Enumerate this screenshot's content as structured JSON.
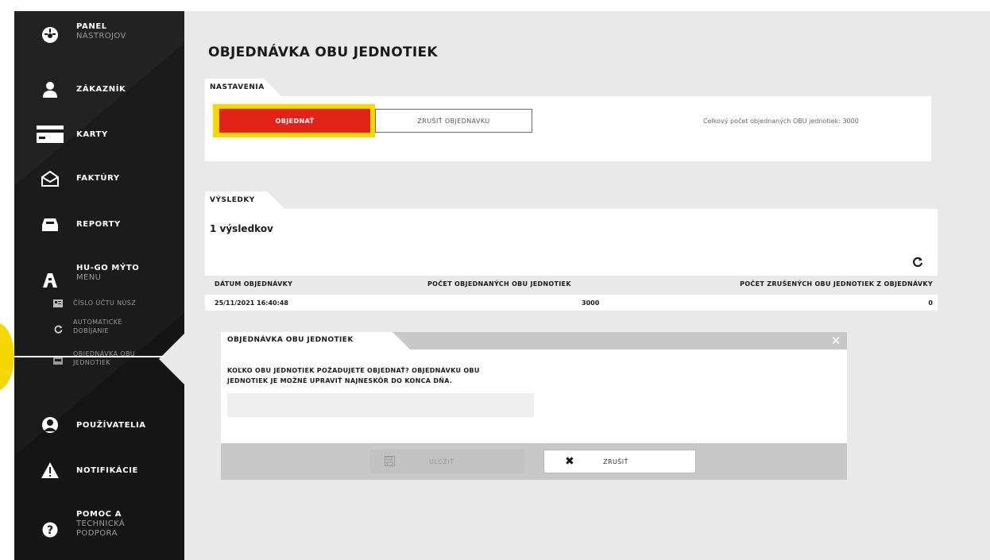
{
  "colors": {
    "accent_red": "#e2231a",
    "highlight_yellow": "#f5d800",
    "sidebar_bg": "#1b1b1b",
    "content_bg": "#e9e9e9"
  },
  "sidebar": {
    "items": [
      {
        "label": "PANEL",
        "sub": "NÁSTROJOV",
        "icon": "dashboard-icon"
      },
      {
        "label": "ZÁKAZNÍK",
        "icon": "user-icon"
      },
      {
        "label": "KARTY",
        "icon": "card-icon"
      },
      {
        "label": "FAKTÚRY",
        "icon": "envelope-icon"
      },
      {
        "label": "REPORTY",
        "icon": "inbox-icon"
      },
      {
        "label": "HU-GO MÝTO",
        "sub": "MENU",
        "icon": "hugo-logo-icon"
      },
      {
        "label": "POUŽÍVATELIA",
        "icon": "user-circle-icon"
      },
      {
        "label": "NOTIFIKÁCIE",
        "icon": "warning-icon"
      },
      {
        "label": "POMOC A",
        "sub": "TECHNICKÁ",
        "sub2": "PODPORA",
        "icon": "help-icon"
      }
    ],
    "subitems": [
      {
        "label": "ČÍSLO ÚČTU NÚSZ",
        "icon": "id-card-icon"
      },
      {
        "label": "AUTOMATICKÉ",
        "label2": "DOBÍJANIE",
        "icon": "refresh-icon"
      },
      {
        "label": "OBJEDNÁVKA OBU",
        "label2": "JEDNOTIEK",
        "icon": "device-icon"
      }
    ]
  },
  "main": {
    "title": "OBJEDNÁVKA OBU JEDNOTIEK",
    "settings": {
      "tab": "NASTAVENIA",
      "order_button": "OBJEDNAŤ",
      "cancel_order_button": "ZRUŠIŤ OBJEDNÁVKU",
      "total_count": "Celkový počet objednaných OBU jednotiek: 3000"
    },
    "results": {
      "tab": "VÝSLEDKY",
      "count": "1 výsledkov",
      "columns": [
        "DÁTUM OBJEDNÁVKY",
        "POČET OBJEDNANÝCH OBU JEDNOTIEK",
        "POČET ZRUŠENÝCH OBU JEDNOTIEK Z OBJEDNÁVKY"
      ],
      "rows": [
        [
          "25/11/2021 16:40:48",
          "3000",
          "0"
        ]
      ]
    }
  },
  "modal": {
    "title": "OBJEDNÁVKA OBU JEDNOTIEK",
    "question_line1": "KOĽKO OBU JEDNOTIEK POŽADUJETE OBJEDNAŤ? OBJEDNÁVKU OBU",
    "question_line2": "JEDNOTIEK JE MOŽNÉ UPRAVIŤ NAJNESKÔR DO KONCA DŇA.",
    "input_value": "",
    "save_button": "ULOŽIŤ",
    "cancel_button": "ZRUŠIŤ"
  }
}
